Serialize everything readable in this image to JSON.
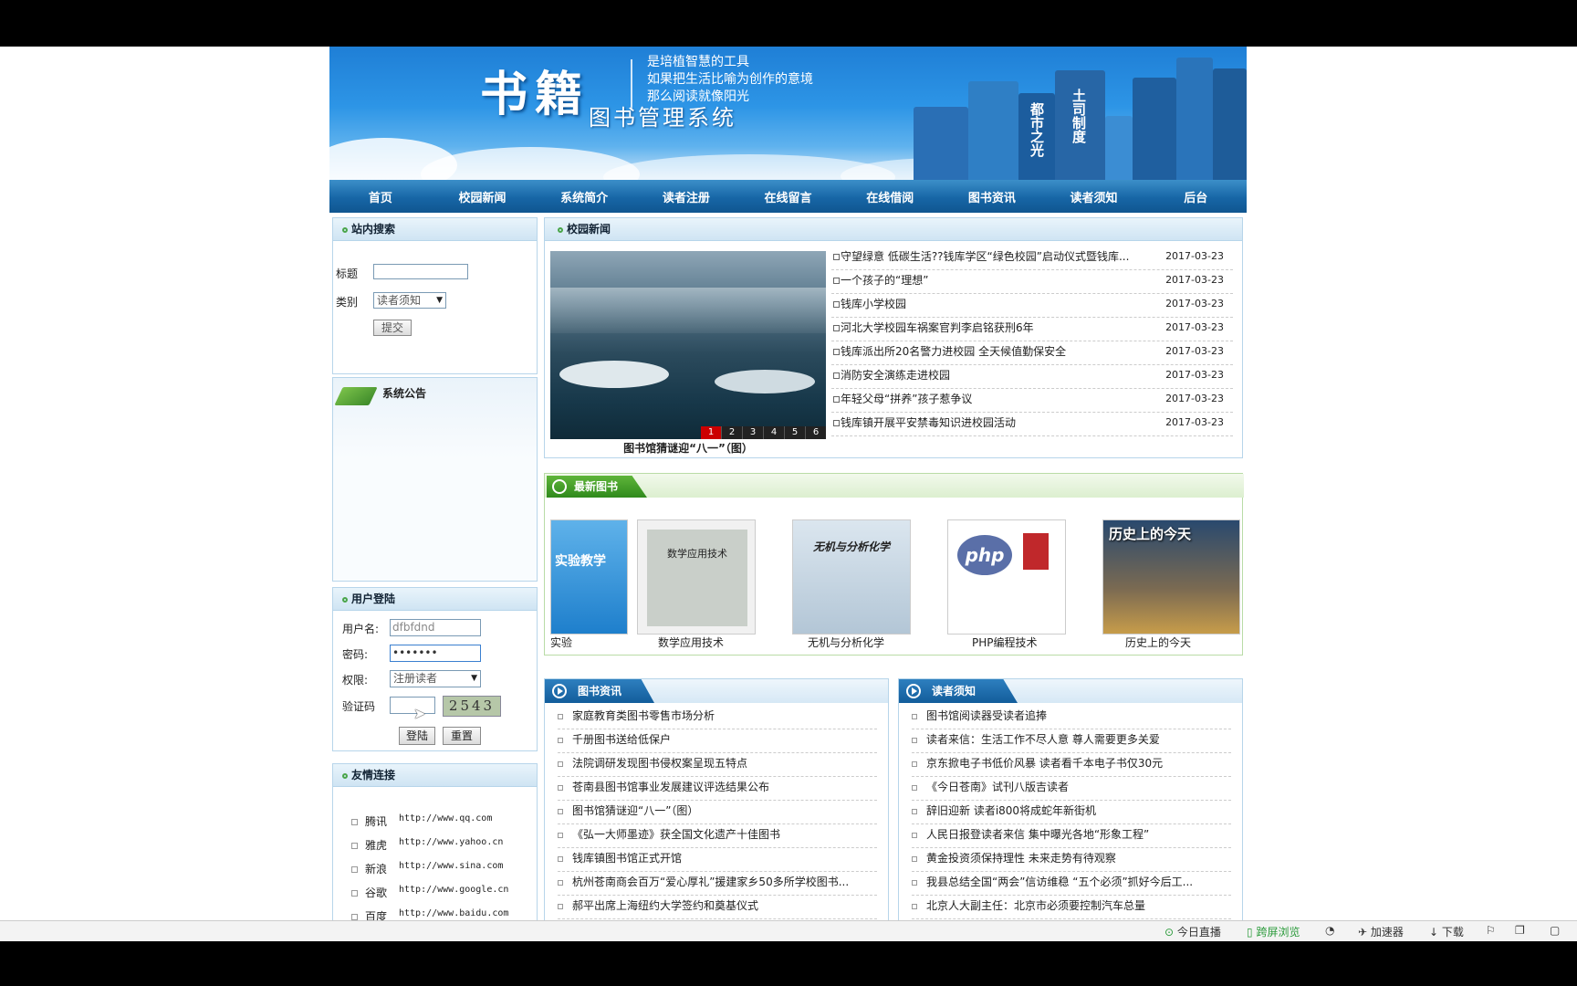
{
  "banner": {
    "logo": "书籍",
    "slogans": [
      "是培植智慧的工具",
      "如果把生活比喻为创作的意境",
      "那么阅读就像阳光"
    ],
    "system_name": "图书管理系统",
    "book_spines": [
      "都市之光",
      "土司制度"
    ]
  },
  "nav": [
    "首页",
    "校园新闻",
    "系统简介",
    "读者注册",
    "在线留言",
    "在线借阅",
    "图书资讯",
    "读者须知",
    "后台"
  ],
  "search": {
    "title": "站内搜索",
    "label_title": "标题",
    "label_category": "类别",
    "category_value": "读者须知",
    "submit": "提交"
  },
  "announcement": {
    "title": "系统公告"
  },
  "login": {
    "title": "用户登陆",
    "label_user": "用户名:",
    "user_value": "dfbfdnd",
    "label_password": "密码:",
    "password_value": "•••••••",
    "label_role": "权限:",
    "role_value": "注册读者",
    "label_captcha": "验证码",
    "captcha_image_text": "2543",
    "login_button": "登陆",
    "reset_button": "重置"
  },
  "links": {
    "title": "友情连接",
    "items": [
      {
        "name": "腾讯",
        "url": "http://www.qq.com"
      },
      {
        "name": "雅虎",
        "url": "http://www.yahoo.cn"
      },
      {
        "name": "新浪",
        "url": "http://www.sina.com"
      },
      {
        "name": "谷歌",
        "url": "http://www.google.cn"
      },
      {
        "name": "百度",
        "url": "http://www.baidu.com"
      }
    ]
  },
  "campus_news": {
    "title": "校园新闻",
    "slider_pages": [
      "1",
      "2",
      "3",
      "4",
      "5",
      "6"
    ],
    "slider_caption": "图书馆猜谜迎“八一”（图）",
    "items": [
      {
        "title": "守望绿意 低碳生活??钱库学区“绿色校园”启动仪式暨钱库...",
        "date": "2017-03-23"
      },
      {
        "title": "一个孩子的“理想”",
        "date": "2017-03-23"
      },
      {
        "title": "钱库小学校园",
        "date": "2017-03-23"
      },
      {
        "title": "河北大学校园车祸案官判李启铭获刑6年",
        "date": "2017-03-23"
      },
      {
        "title": "钱库派出所20名警力进校园 全天候值勤保安全",
        "date": "2017-03-23"
      },
      {
        "title": "消防安全演练走进校园",
        "date": "2017-03-23"
      },
      {
        "title": "年轻父母“拼养”孩子惹争议",
        "date": "2017-03-23"
      },
      {
        "title": "钱库镇开展平安禁毒知识进校园活动",
        "date": "2017-03-23"
      }
    ]
  },
  "new_books": {
    "title": "最新图书",
    "items": [
      {
        "caption": "实验",
        "cover_text": "实验教学"
      },
      {
        "caption": "数学应用技术",
        "cover_text": "数学应用技术"
      },
      {
        "caption": "无机与分析化学",
        "cover_text": "无机与分析化学"
      },
      {
        "caption": "PHP编程技术",
        "cover_text": "php"
      },
      {
        "caption": "历史上的今天",
        "cover_text": "历史上的今天"
      }
    ]
  },
  "book_info": {
    "title": "图书资讯",
    "items": [
      "家庭教育类图书零售市场分析",
      "千册图书送给低保户",
      "法院调研发现图书侵权案呈现五特点",
      "苍南县图书馆事业发展建议评选结果公布",
      "图书馆猜谜迎“八一”（图）",
      "《弘一大师墨迹》获全国文化遗产十佳图书",
      "钱库镇图书馆正式开馆",
      "杭州苍南商会百万“爱心厚礼”援建家乡50多所学校图书...",
      "郝平出席上海纽约大学签约和奠基仪式"
    ]
  },
  "reader_notice": {
    "title": "读者须知",
    "items": [
      "图书馆阅读器受读者追捧",
      "读者来信：生活工作不尽人意 尊人需要更多关爱",
      "京东掀电子书低价风暴 读者看千本电子书仅30元",
      "《今日苍南》试刊八版吉读者",
      "辞旧迎新 读者i800将成蛇年新街机",
      "人民日报登读者来信 集中曝光各地“形象工程”",
      "黄金投资须保持理性 未来走势有待观察",
      "我县总结全国“两会”信访维稳 “五个必须”抓好今后工...",
      "北京人大副主任：北京市必须要控制汽车总量"
    ]
  },
  "taskbar": [
    "今日直播",
    "跨屏浏览",
    "加速器",
    "下载"
  ],
  "colors": {
    "nav": "#1766a6",
    "banner": "#2d95e6",
    "accent_green": "#4aa54a"
  }
}
